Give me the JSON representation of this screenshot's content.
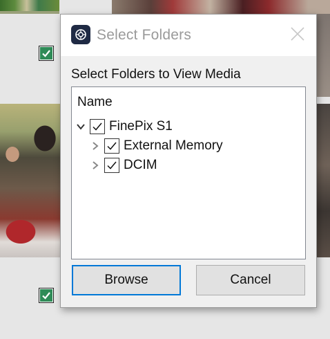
{
  "dialog": {
    "title": "Select Folders",
    "prompt": "Select Folders to View Media",
    "tree": {
      "column_header": "Name",
      "nodes": [
        {
          "label": "FinePix S1",
          "checked": true,
          "expanded": true,
          "level": 0
        },
        {
          "label": "External Memory",
          "checked": true,
          "expanded": false,
          "level": 1
        },
        {
          "label": "DCIM",
          "checked": true,
          "expanded": false,
          "level": 1
        }
      ]
    },
    "buttons": {
      "browse": "Browse",
      "cancel": "Cancel"
    },
    "icons": {
      "app": "app-logo-icon",
      "close": "close-icon",
      "expand": "chevron-right-icon",
      "collapse": "chevron-down-icon",
      "check": "checkmark-icon"
    }
  },
  "background": {
    "thumbnail_checkboxes": [
      {
        "checked": true
      },
      {
        "checked": true
      }
    ]
  },
  "colors": {
    "accent": "#0078d7",
    "dialog_bg": "#f0f0f0",
    "check_green": "#2e8b57"
  }
}
